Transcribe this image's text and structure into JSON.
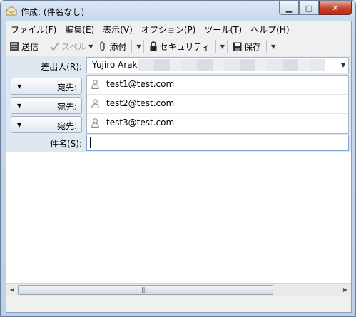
{
  "window": {
    "title": "作成: (件名なし)",
    "minimize": "▁",
    "maximize": "□",
    "close": "✕"
  },
  "menu": [
    "ファイル(F)",
    "編集(E)",
    "表示(V)",
    "オプション(P)",
    "ツール(T)",
    "ヘルプ(H)"
  ],
  "toolbar": {
    "send": "送信",
    "spell": "スペル",
    "attach": "添付",
    "security": "セキュリティ",
    "save": "保存"
  },
  "header": {
    "from_label": "差出人(R):",
    "from_value": "Yujiro Araki",
    "recipient_type_label": "宛先:",
    "recipients": [
      "test1@test.com",
      "test2@test.com",
      "test3@test.com"
    ],
    "subject_label": "件名(S):",
    "subject_value": ""
  },
  "icons": {
    "app": "compose-icon",
    "send": "send-icon",
    "spell": "check-icon",
    "attach": "paperclip-icon",
    "security": "lock-icon",
    "save": "floppy-icon",
    "recipient": "person-icon"
  }
}
